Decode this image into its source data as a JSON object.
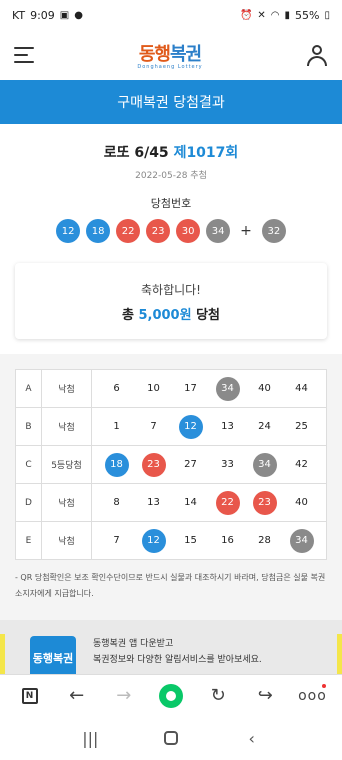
{
  "status_bar": {
    "carrier": "KT",
    "time": "9:09",
    "battery": "55%"
  },
  "header": {
    "logo_main_1": "동행",
    "logo_main_2": "복권",
    "logo_sub": "Donghaeng Lottery"
  },
  "page_title": "구매복권 당첨결과",
  "draw": {
    "game": "로또 6/45",
    "round": "제1017회",
    "date": "2022-05-28 추첨",
    "winning_label": "당첨번호",
    "winning_numbers": [
      "12",
      "18",
      "22",
      "23",
      "30",
      "34"
    ],
    "plus": "+",
    "bonus_number": "32"
  },
  "result": {
    "message": "축하합니다!",
    "prefix": "총",
    "amount": "5,000원",
    "suffix": "당첨"
  },
  "tickets": [
    {
      "game": "A",
      "status": "낙첨",
      "numbers": [
        "6",
        "10",
        "17",
        "34",
        "40",
        "44"
      ],
      "hits": [
        false,
        false,
        false,
        true,
        false,
        false
      ]
    },
    {
      "game": "B",
      "status": "낙첨",
      "numbers": [
        "1",
        "7",
        "12",
        "13",
        "24",
        "25"
      ],
      "hits": [
        false,
        false,
        true,
        false,
        false,
        false
      ]
    },
    {
      "game": "C",
      "status": "5등당첨",
      "numbers": [
        "18",
        "23",
        "27",
        "33",
        "34",
        "42"
      ],
      "hits": [
        true,
        true,
        false,
        false,
        true,
        false
      ]
    },
    {
      "game": "D",
      "status": "낙첨",
      "numbers": [
        "8",
        "13",
        "14",
        "22",
        "23",
        "40"
      ],
      "hits": [
        false,
        false,
        false,
        true,
        true,
        false
      ]
    },
    {
      "game": "E",
      "status": "낙첨",
      "numbers": [
        "7",
        "12",
        "15",
        "16",
        "28",
        "34"
      ],
      "hits": [
        false,
        true,
        false,
        false,
        false,
        true
      ]
    }
  ],
  "notice": "- QR 당첨확인은 보조 확인수단이므로 반드시 실물과 대조하시기 바라며, 당첨금은 실물 복권소지자에게 지급합니다.",
  "promo": {
    "logo": "동행복권",
    "line1": "동행복권 앱 다운받고",
    "line2": "복권정보와 다양한 알림서비스를 받아보세요."
  },
  "browser_bar": {
    "n_label": "N",
    "back": "←",
    "forward": "→",
    "refresh": "↻",
    "share": "↪",
    "more": "ooo"
  },
  "nav_bar": {
    "recent": "|||",
    "back": "‹"
  },
  "colors": {
    "accent": "#1d8ad6",
    "ball_blue": "#2a8fdb",
    "ball_red": "#e8574b",
    "ball_gray": "#8a8a8a",
    "ball_yellow": "#f2b92b"
  }
}
